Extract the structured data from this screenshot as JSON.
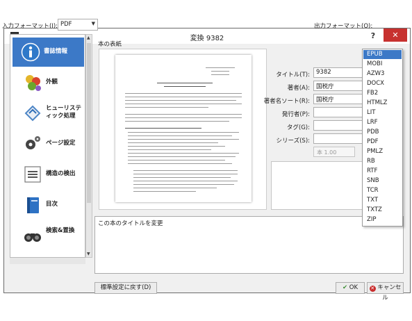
{
  "window": {
    "title": "変換 9382",
    "help_label": "?",
    "close_label": "✕"
  },
  "input_format": {
    "label": "入力フォーマット(I):",
    "value": "PDF"
  },
  "output_format": {
    "label": "出力フォーマット(O):",
    "options": [
      "EPUB",
      "MOBI",
      "AZW3",
      "DOCX",
      "FB2",
      "HTMLZ",
      "LIT",
      "LRF",
      "PDB",
      "PDF",
      "PMLZ",
      "RB",
      "RTF",
      "SNB",
      "TCR",
      "TXT",
      "TXTZ",
      "ZIP"
    ],
    "selected": "EPUB"
  },
  "sidebar": {
    "items": [
      {
        "label": "書誌情報",
        "icon": "info-icon",
        "selected": true
      },
      {
        "label": "外観",
        "icon": "appearance-icon",
        "selected": false
      },
      {
        "label": "ヒューリスティック処理",
        "icon": "heuristics-icon",
        "selected": false
      },
      {
        "label": "ページ設定",
        "icon": "page-setup-icon",
        "selected": false
      },
      {
        "label": "構造の検出",
        "icon": "structure-icon",
        "selected": false
      },
      {
        "label": "目次",
        "icon": "toc-icon",
        "selected": false
      },
      {
        "label": "検索&置換",
        "icon": "search-replace-icon",
        "selected": false
      }
    ]
  },
  "cover": {
    "label": "本の表紙"
  },
  "metadata": {
    "title_label": "タイトル(T):",
    "title_value": "9382",
    "author_label": "著者(A):",
    "author_value": "国税庁",
    "author_sort_label": "著者名ソート(R):",
    "author_sort_value": "国税庁",
    "publisher_label": "発行者(P):",
    "publisher_value": "",
    "tags_label": "タグ(G):",
    "tags_value": "",
    "series_label": "シリーズ(S):",
    "series_value": "",
    "series_number": "本 1.00"
  },
  "help_text": "この本のタイトルを変更",
  "buttons": {
    "reset": "標準設定に戻す(D)",
    "ok": "OK",
    "cancel": "キャンセル"
  },
  "colors": {
    "accent": "#3c79c7",
    "close": "#c7312f"
  }
}
